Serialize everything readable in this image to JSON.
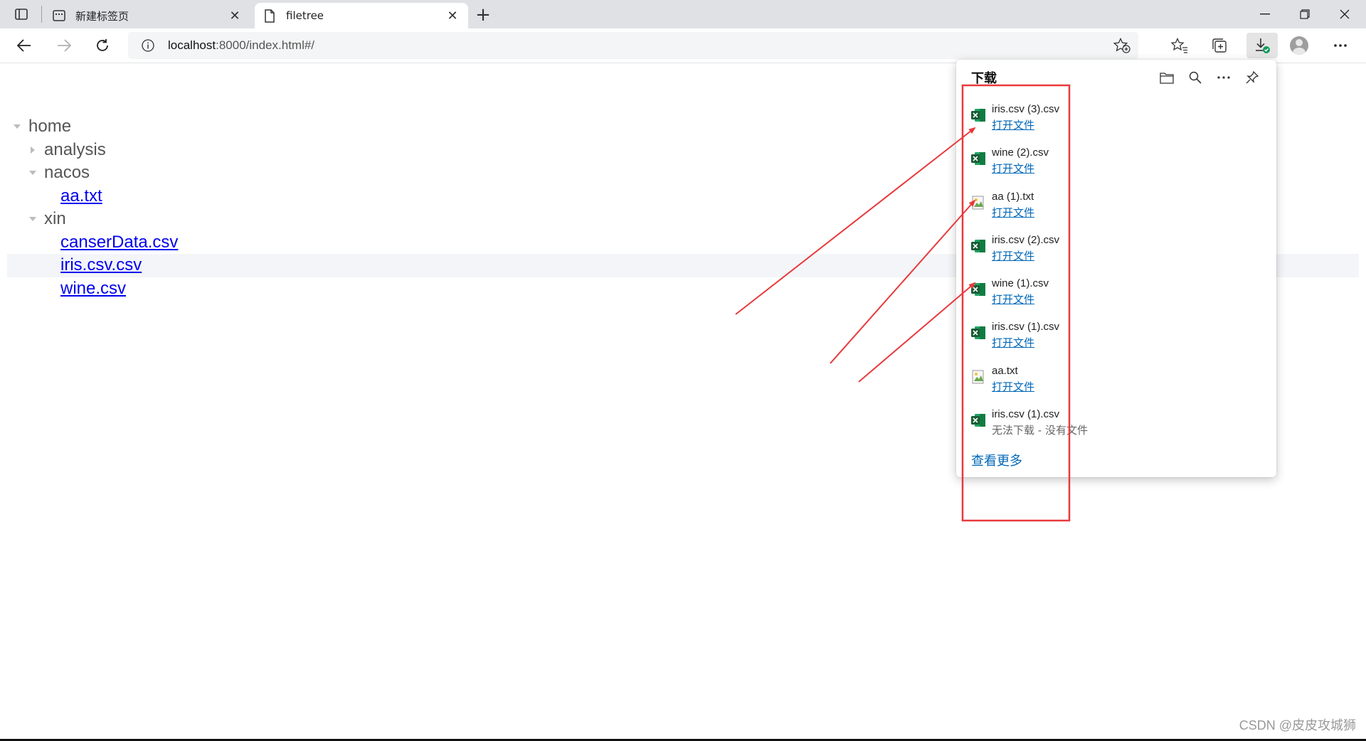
{
  "browser": {
    "tabs": [
      {
        "title": "新建标签页",
        "active": false,
        "icon": "new-tab-page-icon"
      },
      {
        "title": "filetree",
        "active": true,
        "icon": "document-icon"
      }
    ],
    "address": {
      "host": "localhost",
      "path": ":8000/index.html#/"
    }
  },
  "tree": {
    "nodes": [
      {
        "label": "home",
        "type": "folder",
        "expanded": true,
        "level": 0
      },
      {
        "label": "analysis",
        "type": "folder",
        "expanded": false,
        "level": 1
      },
      {
        "label": "nacos",
        "type": "folder",
        "expanded": true,
        "level": 1
      },
      {
        "label": "aa.txt",
        "type": "file",
        "level": 2
      },
      {
        "label": "xin",
        "type": "folder",
        "expanded": true,
        "level": 1
      },
      {
        "label": "canserData.csv",
        "type": "file",
        "level": 2
      },
      {
        "label": "iris.csv.csv",
        "type": "file",
        "level": 2,
        "highlighted": true
      },
      {
        "label": "wine.csv",
        "type": "file",
        "level": 2
      }
    ]
  },
  "downloads": {
    "title": "下载",
    "items": [
      {
        "name": "iris.csv (3).csv",
        "action": "打开文件",
        "icon": "excel-icon"
      },
      {
        "name": "wine (2).csv",
        "action": "打开文件",
        "icon": "excel-icon"
      },
      {
        "name": "aa (1).txt",
        "action": "打开文件",
        "icon": "text-file-icon"
      },
      {
        "name": "iris.csv (2).csv",
        "action": "打开文件",
        "icon": "excel-icon"
      },
      {
        "name": "wine (1).csv",
        "action": "打开文件",
        "icon": "excel-icon"
      },
      {
        "name": "iris.csv (1).csv",
        "action": "打开文件",
        "icon": "excel-icon"
      },
      {
        "name": "aa.txt",
        "action": "打开文件",
        "icon": "text-file-icon"
      },
      {
        "name": "iris.csv (1).csv",
        "status": "无法下载 - 没有文件",
        "icon": "excel-icon"
      }
    ],
    "see_more": "查看更多"
  },
  "annotation": {
    "color": "#e8393c"
  },
  "watermark": "CSDN @皮皮攻城狮"
}
